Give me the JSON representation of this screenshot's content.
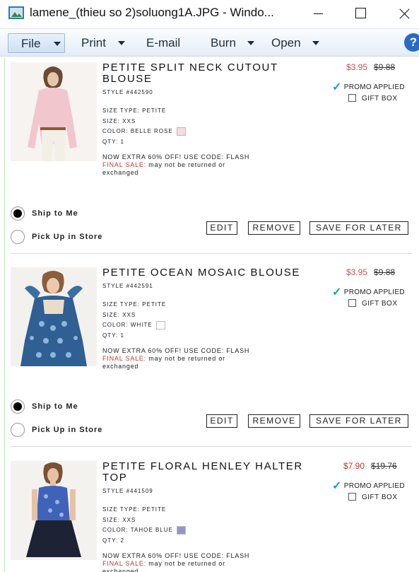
{
  "window": {
    "title": "lamene_(thieu so 2)soluong1A.JPG - Windo..."
  },
  "menubar": {
    "items": [
      {
        "label": "File",
        "has_dropdown": true
      },
      {
        "label": "Print",
        "has_dropdown": true
      },
      {
        "label": "E-mail",
        "has_dropdown": false
      },
      {
        "label": "Burn",
        "has_dropdown": true
      },
      {
        "label": "Open",
        "has_dropdown": true
      }
    ],
    "help_glyph": "?"
  },
  "colors": {
    "sale_price": "#c0535b",
    "final_sale": "#c0392b",
    "check": "#1aa39a",
    "menubar": "#e3ecf6"
  },
  "products": [
    {
      "name": "PETITE SPLIT NECK CUTOUT BLOUSE",
      "style": "STYLE #442590",
      "size_type": "SIZE TYPE: PETITE",
      "size": "SIZE: XXS",
      "color_label": "COLOR: BELLE ROSE",
      "swatch_color": "#f3dde0",
      "qty": "QTY: 1",
      "promo_text": "NOW EXTRA 60% OFF! USE CODE: FLASH",
      "final_label": "FINAL SALE:",
      "final_text": " may not be returned or",
      "final_text2": "exchanged",
      "sale_price": "$3.95",
      "orig_price": "$9.88",
      "promo_applied": "PROMO APPLIED",
      "gift_box": "GIFT BOX",
      "ship_label": "Ship to Me",
      "pickup_label": "Pick Up in Store",
      "edit": "EDIT",
      "remove": "REMOVE",
      "save_later": "SAVE FOR LATER"
    },
    {
      "name": "PETITE OCEAN MOSAIC BLOUSE",
      "style": "STYLE #442591",
      "size_type": "SIZE TYPE: PETITE",
      "size": "SIZE: XXS",
      "color_label": "COLOR: WHITE",
      "swatch_color": "#ffffff",
      "qty": "QTY: 1",
      "promo_text": "NOW EXTRA 60% OFF! USE CODE: FLASH",
      "final_label": "FINAL SALE:",
      "final_text": " may not be returned or",
      "final_text2": "exchanged",
      "sale_price": "$3.95",
      "orig_price": "$9.88",
      "promo_applied": "PROMO APPLIED",
      "gift_box": "GIFT BOX",
      "ship_label": "Ship to Me",
      "pickup_label": "Pick Up in Store",
      "edit": "EDIT",
      "remove": "REMOVE",
      "save_later": "SAVE FOR LATER"
    },
    {
      "name": "PETITE FLORAL HENLEY HALTER TOP",
      "style": "STYLE #441509",
      "size_type": "SIZE TYPE: PETITE",
      "size": "SIZE: XXS",
      "color_label": "COLOR: TAHOE BLUE",
      "swatch_color": "#8f97c9",
      "qty": "QTY: 2",
      "promo_text": "NOW EXTRA 60% OFF! USE CODE: FLASH",
      "final_label": "FINAL SALE:",
      "final_text": " may not be returned or",
      "final_text2": "exchanged",
      "sale_price": "$7.90",
      "orig_price": "$19.76",
      "promo_applied": "PROMO APPLIED",
      "gift_box": "GIFT BOX"
    }
  ]
}
